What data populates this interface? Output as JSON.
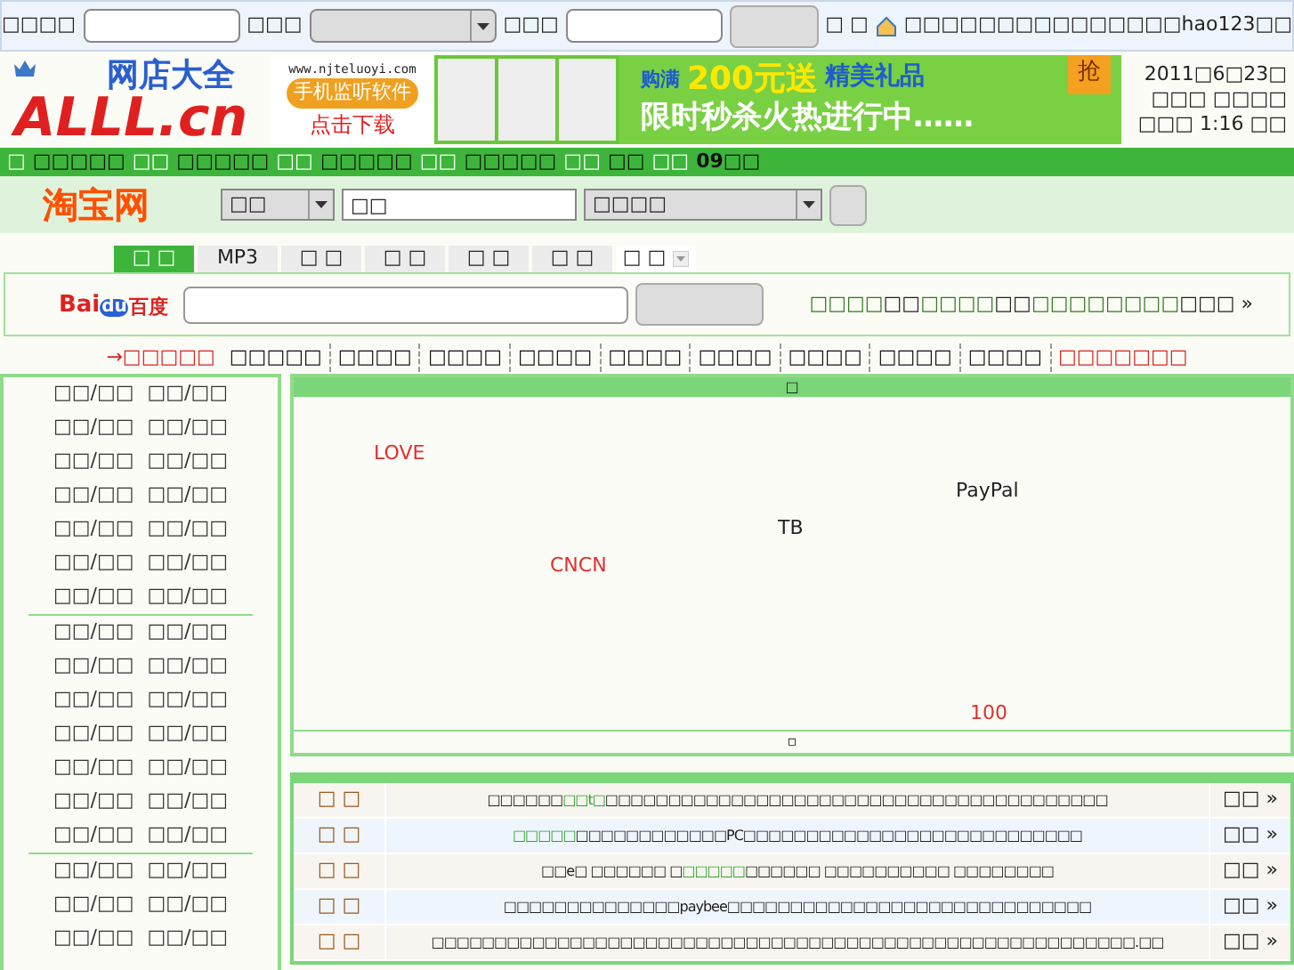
{
  "top_bar": {
    "fields": [
      {
        "label": "□□□□",
        "kind": "input"
      },
      {
        "label": "□□□",
        "kind": "select"
      },
      {
        "label": "□□□",
        "kind": "input"
      }
    ],
    "after_button": "□ □",
    "home_link": "□□□□□□□□□□□□□□□hao123□□"
  },
  "header": {
    "logo": {
      "main": "ALLL.cn",
      "tag": "网店大全"
    },
    "banner": {
      "site": "www.njteluoyi.com",
      "product": "手机监听软件",
      "cta": "点击下载",
      "headline_prefix": "购满",
      "amount": "200元送",
      "gift": "精美礼品",
      "slogan": "限时秒杀火热进行中……",
      "badge": "抢"
    },
    "date": [
      "2011□6□23□",
      "□□□ □□□□",
      "□□□ 1:16 □□"
    ]
  },
  "green_bar": [
    "□",
    "□□□□□",
    "□□",
    "□□□□□",
    "□□",
    "□□□□□",
    "□□",
    "□□□□□",
    "□□",
    "□□",
    "□□",
    "09□□"
  ],
  "taobao": {
    "logo": "淘宝网",
    "category": "□□",
    "query": "□□",
    "sort": "□□□□"
  },
  "search_tabs": [
    {
      "label": "□ □",
      "selected": true
    },
    {
      "label": "MP3",
      "selected": false
    },
    {
      "label": "□ □",
      "selected": false
    },
    {
      "label": "□ □",
      "selected": false
    },
    {
      "label": "□ □",
      "selected": false
    },
    {
      "label": "□ □",
      "selected": false
    },
    {
      "label": "□ □",
      "selected": false,
      "kind": "dropdown"
    }
  ],
  "baidu": {
    "logo_left": "Bai",
    "logo_paw": "du",
    "logo_right": "百度",
    "links": [
      {
        "text": "□□□□",
        "kind": "link"
      },
      {
        "text": "□□",
        "kind": "plain"
      },
      {
        "text": "□□□□",
        "kind": "link"
      },
      {
        "text": "□□",
        "kind": "plain"
      },
      {
        "text": "□□□□□□□□",
        "kind": "link"
      },
      {
        "text": "□□□ »",
        "kind": "plain"
      }
    ]
  },
  "quick_links": [
    {
      "text": "→□□□□□",
      "kind": "highlight"
    },
    {
      "text": "□□□□□",
      "kind": "normal"
    },
    {
      "text": "□□□□",
      "kind": "normal"
    },
    {
      "text": "□□□□",
      "kind": "normal"
    },
    {
      "text": "□□□□",
      "kind": "normal"
    },
    {
      "text": "□□□□",
      "kind": "normal"
    },
    {
      "text": "□□□□",
      "kind": "normal"
    },
    {
      "text": "□□□□",
      "kind": "normal"
    },
    {
      "text": "□□□□",
      "kind": "normal"
    },
    {
      "text": "□□□□",
      "kind": "normal"
    },
    {
      "text": "□□□□□□□",
      "kind": "highlight"
    }
  ],
  "sidebar": {
    "groups": [
      [
        [
          "□□/□□",
          "□□/□□"
        ],
        [
          "□□/□□",
          "□□/□□"
        ],
        [
          "□□/□□",
          "□□/□□"
        ],
        [
          "□□/□□",
          "□□/□□"
        ],
        [
          "□□/□□",
          "□□/□□"
        ],
        [
          "□□/□□",
          "□□/□□"
        ],
        [
          "□□/□□",
          "□□/□□"
        ]
      ],
      [
        [
          "□□/□□",
          "□□/□□"
        ],
        [
          "□□/□□",
          "□□/□□"
        ],
        [
          "□□/□□",
          "□□/□□"
        ],
        [
          "□□/□□",
          "□□/□□"
        ],
        [
          "□□/□□",
          "□□/□□"
        ],
        [
          "□□/□□",
          "□□/□□"
        ],
        [
          "□□/□□",
          "□□/□□"
        ]
      ],
      [
        [
          "□□/□□",
          "□□/□□"
        ],
        [
          "□□/□□",
          "□□/□□"
        ],
        [
          "□□/□□",
          "□□/□□"
        ]
      ]
    ]
  },
  "tag_panel": {
    "title": "□",
    "tags": [
      {
        "text": "LOVE",
        "color": "#e03030"
      },
      {
        "text": "PayPal",
        "color": "#222222"
      },
      {
        "text": "TB",
        "color": "#222222"
      },
      {
        "text": "CNCN",
        "color": "#e03030"
      },
      {
        "text": "100",
        "color": "#e03030"
      }
    ],
    "footer": "▫"
  },
  "news": [
    {
      "tag": "□ □",
      "parts": [
        {
          "t": "□□□□□□",
          "highlight": false
        },
        {
          "t": "□□t□",
          "highlight": true
        },
        {
          "t": "□□□□□□□□□□□□□□□□□□□□□□□□□□□□□□□□□□□□□□□□",
          "highlight": false
        }
      ],
      "more": "□□ »"
    },
    {
      "tag": "□ □",
      "parts": [
        {
          "t": "□□□□□",
          "highlight": true
        },
        {
          "t": "□□□□□□□□□□□□PC□□□□□□□□□□□□□□□□□□□□□□□□□□□",
          "highlight": false
        }
      ],
      "more": "□□ »"
    },
    {
      "tag": "□ □",
      "parts": [
        {
          "t": "□□e□ □□□□□□ □",
          "highlight": false
        },
        {
          "t": "□□□□□",
          "highlight": true
        },
        {
          "t": " □□□□□□ □□□□□□□□□□ □□□□□□□□",
          "highlight": false
        }
      ],
      "more": "□□ »"
    },
    {
      "tag": "□ □",
      "parts": [
        {
          "t": "□□□□□□□□□□□□□□paybee□□□□□□□□□□□□□□□□□□□□□□□□□□□□□",
          "highlight": false
        }
      ],
      "more": "□□ »"
    },
    {
      "tag": "□ □",
      "parts": [
        {
          "t": "□□□□□□□□□□□□□□□□□□□□□□□□□□□□□□□□□□□□□□□□□□□□□□□□□□□□□□□□.□□",
          "highlight": false
        }
      ],
      "more": "□□ »"
    }
  ]
}
